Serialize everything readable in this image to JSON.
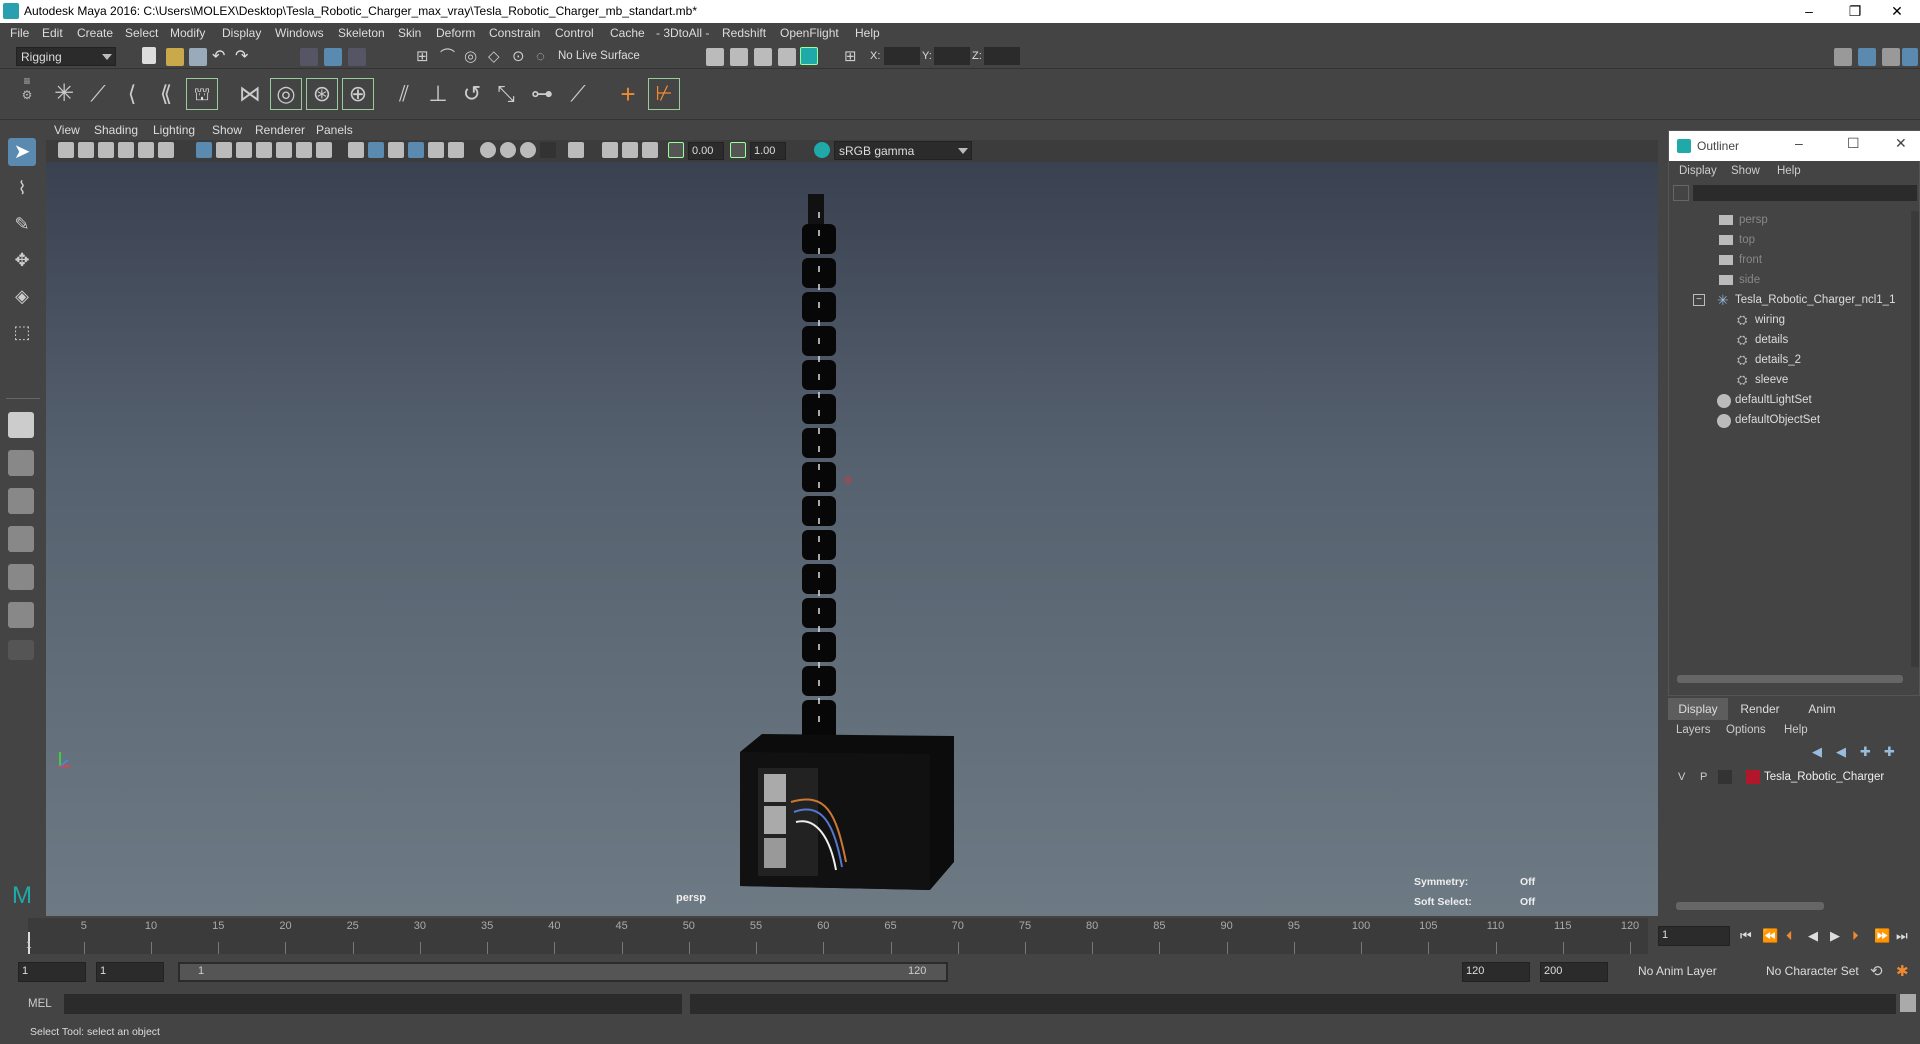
{
  "window": {
    "title": "Autodesk Maya 2016: C:\\Users\\MOLEX\\Desktop\\Tesla_Robotic_Charger_max_vray\\Tesla_Robotic_Charger_mb_standart.mb*",
    "minimize": "–",
    "maximize": "❐",
    "close": "✕"
  },
  "menubar": [
    "File",
    "Edit",
    "Create",
    "Select",
    "Modify",
    "Display",
    "Windows",
    "Skeleton",
    "Skin",
    "Deform",
    "Constrain",
    "Control",
    "Cache",
    "- 3DtoAll -",
    "Redshift",
    "OpenFlight",
    "Help"
  ],
  "statusline": {
    "menuset": "Rigging",
    "live_surface": "No Live Surface",
    "x_label": "X:",
    "y_label": "Y:",
    "z_label": "Z:"
  },
  "panel": {
    "menus": [
      "View",
      "Shading",
      "Lighting",
      "Show",
      "Renderer",
      "Panels"
    ],
    "exposure": "0.00",
    "gamma": "1.00",
    "colorspace": "sRGB gamma",
    "camera_label": "persp",
    "symmetry_label": "Symmetry:",
    "symmetry_value": "Off",
    "soft_select_label": "Soft Select:",
    "soft_select_value": "Off"
  },
  "outliner": {
    "title": "Outliner",
    "menus": [
      "Display",
      "Show",
      "Help"
    ],
    "items": [
      {
        "label": "persp",
        "type": "camera",
        "dim": true
      },
      {
        "label": "top",
        "type": "camera",
        "dim": true
      },
      {
        "label": "front",
        "type": "camera",
        "dim": true
      },
      {
        "label": "side",
        "type": "camera",
        "dim": true
      },
      {
        "label": "Tesla_Robotic_Charger_ncl1_1",
        "type": "group",
        "dim": false
      },
      {
        "label": "wiring",
        "type": "mesh",
        "dim": false
      },
      {
        "label": "details",
        "type": "mesh",
        "dim": false
      },
      {
        "label": "details_2",
        "type": "mesh",
        "dim": false
      },
      {
        "label": "sleeve",
        "type": "mesh",
        "dim": false
      },
      {
        "label": "defaultLightSet",
        "type": "set",
        "dim": false
      },
      {
        "label": "defaultObjectSet",
        "type": "set",
        "dim": false
      }
    ]
  },
  "layers": {
    "tabs": [
      "Display",
      "Render",
      "Anim"
    ],
    "menus": [
      "Layers",
      "Options",
      "Help"
    ],
    "rows": [
      {
        "v": "V",
        "p": "P",
        "name": "Tesla_Robotic_Charger",
        "color": "#b0182a"
      }
    ]
  },
  "timeline": {
    "ticks": [
      "5",
      "10",
      "15",
      "20",
      "25",
      "30",
      "35",
      "40",
      "45",
      "50",
      "55",
      "60",
      "65",
      "70",
      "75",
      "80",
      "85",
      "90",
      "95",
      "100",
      "105",
      "110",
      "115",
      "120"
    ],
    "current_frame_label": "1",
    "current_frame_field": "1"
  },
  "range": {
    "start": "1",
    "playback_start": "1",
    "slider_start": "1",
    "slider_end": "120",
    "playback_end": "120",
    "end": "200",
    "anim_layer": "No Anim Layer",
    "character_set": "No Character Set"
  },
  "cmdline": {
    "label": "MEL"
  },
  "helpline": {
    "text": "Select Tool: select an object"
  },
  "colors": {
    "accent": "#5a8ab0",
    "layer_color": "#b0182a"
  }
}
